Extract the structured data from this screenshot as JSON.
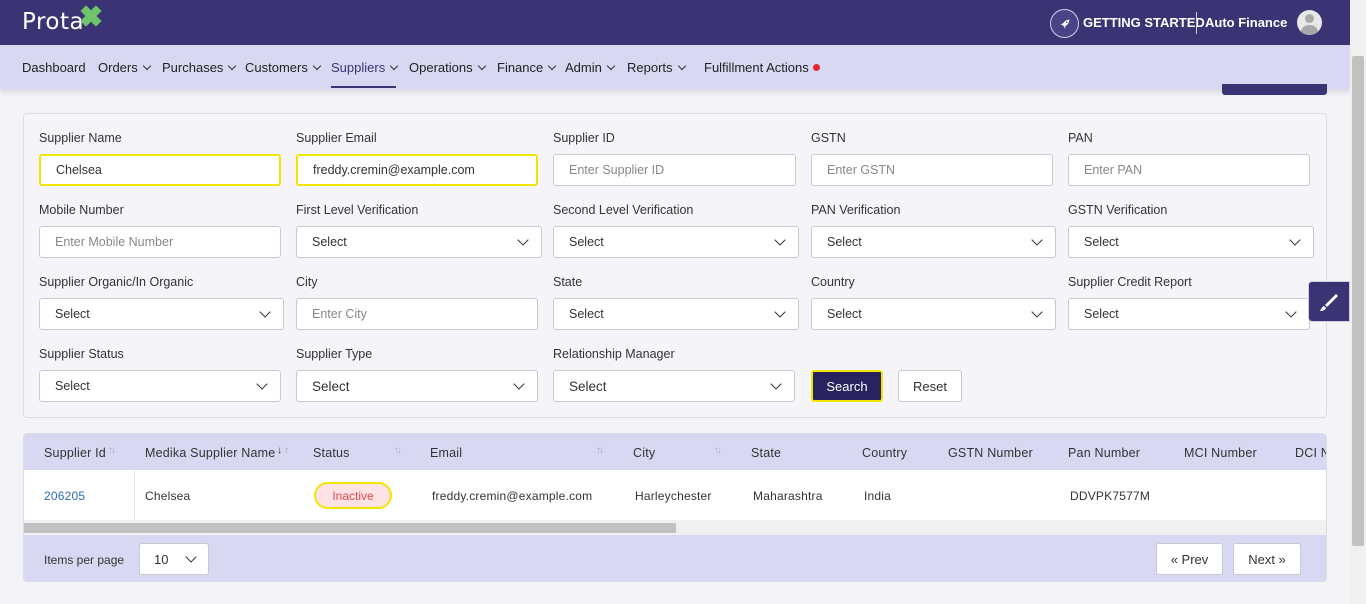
{
  "header": {
    "brand": "Prota",
    "getting_started": "GETTING STARTED",
    "company": "Auto Finance",
    "rocket_icon": "rocket-icon",
    "avatar_icon": "user-avatar-icon"
  },
  "nav": {
    "items": [
      {
        "label": "Dashboard"
      },
      {
        "label": "Orders"
      },
      {
        "label": "Purchases"
      },
      {
        "label": "Customers"
      },
      {
        "label": "Suppliers"
      },
      {
        "label": "Operations"
      },
      {
        "label": "Finance"
      },
      {
        "label": "Admin"
      },
      {
        "label": "Reports"
      },
      {
        "label": "Fulfillment Actions"
      }
    ],
    "active": "Suppliers"
  },
  "filters": {
    "supplier_name": {
      "label": "Supplier Name",
      "value": "Chelsea"
    },
    "supplier_email": {
      "label": "Supplier Email",
      "value": "freddy.cremin@example.com"
    },
    "supplier_id": {
      "label": "Supplier ID",
      "placeholder": "Enter Supplier ID"
    },
    "gstn": {
      "label": "GSTN",
      "placeholder": "Enter GSTN"
    },
    "pan": {
      "label": "PAN",
      "placeholder": "Enter PAN"
    },
    "mobile": {
      "label": "Mobile Number",
      "placeholder": "Enter Mobile Number"
    },
    "first_level": {
      "label": "First Level Verification",
      "value": "Select"
    },
    "second_level": {
      "label": "Second Level Verification",
      "value": "Select"
    },
    "pan_verification": {
      "label": "PAN Verification",
      "value": "Select"
    },
    "gstn_verification": {
      "label": "GSTN Verification",
      "value": "Select"
    },
    "organic": {
      "label": "Supplier Organic/In Organic",
      "value": "Select"
    },
    "city": {
      "label": "City",
      "placeholder": "Enter City"
    },
    "state": {
      "label": "State",
      "value": "Select"
    },
    "country": {
      "label": "Country",
      "value": "Select"
    },
    "credit_report": {
      "label": "Supplier Credit Report",
      "value": "Select"
    },
    "status": {
      "label": "Supplier Status",
      "value": "Select"
    },
    "type": {
      "label": "Supplier Type",
      "value": "Select"
    },
    "manager": {
      "label": "Relationship Manager",
      "value": "Select"
    },
    "search_label": "Search",
    "reset_label": "Reset"
  },
  "table": {
    "columns": [
      "Supplier Id",
      "Medika Supplier Name",
      "Status",
      "Email",
      "City",
      "State",
      "Country",
      "GSTN Number",
      "Pan Number",
      "MCI Number",
      "DCI N"
    ],
    "rows": [
      {
        "supplier_id": "206205",
        "name": "Chelsea",
        "status": "Inactive",
        "email": "freddy.cremin@example.com",
        "city": "Harleychester",
        "state": "Maharashtra",
        "country": "India",
        "gstn": "",
        "pan": "DDVPK7577M",
        "mci": ""
      }
    ]
  },
  "pagination": {
    "items_per_page_label": "Items per page",
    "items_per_page": "10",
    "prev_label": "« Prev",
    "next_label": "Next »"
  },
  "colors": {
    "brand": "#3a3475",
    "nav_bg": "#d9d8f3",
    "highlight": "#f2e600",
    "inactive": "#e14a4a",
    "notification": "#e0282d"
  }
}
